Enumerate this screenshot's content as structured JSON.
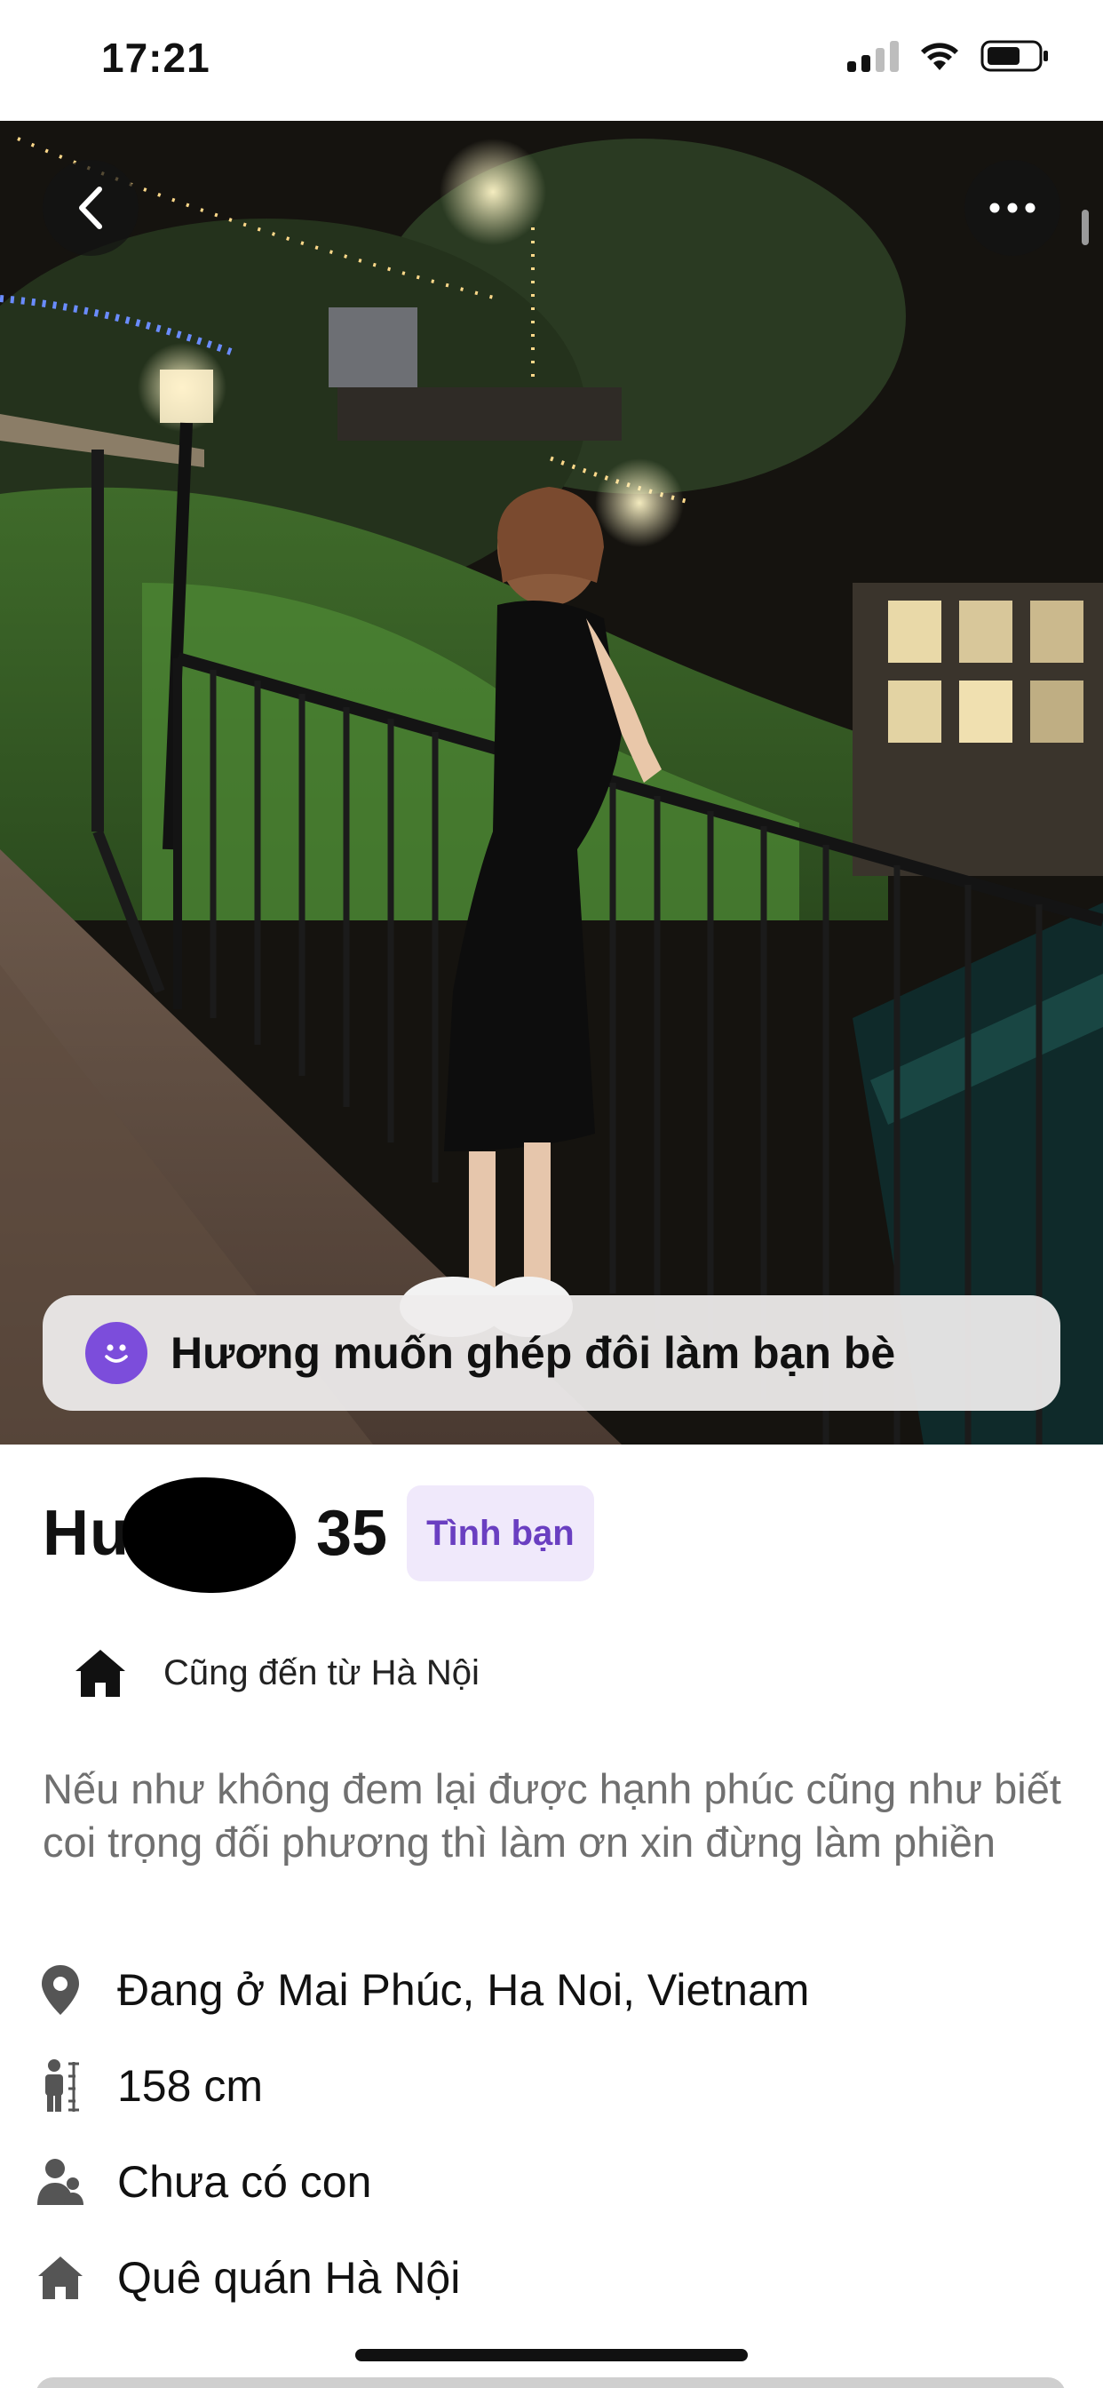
{
  "status_bar": {
    "time": "17:21"
  },
  "hero": {
    "image": "profile-photo-night-balcony",
    "intent_text": "Hương muốn ghép đôi làm bạn bè",
    "intent_emoji_color": "#7c4ddb"
  },
  "profile": {
    "name": "Hu",
    "age": "35",
    "tag": "Tình bạn",
    "hometown_line": "Cũng đến từ Hà Nội",
    "bio": "Nếu như không đem lại được hạnh phúc cũng như biết coi trọng đối phương thì làm ơn xin đừng làm phiền"
  },
  "details": [
    {
      "icon": "location-pin-icon",
      "text": "Đang ở Mai Phúc, Ha Noi, Vietnam"
    },
    {
      "icon": "height-icon",
      "text": "158 cm"
    },
    {
      "icon": "children-icon",
      "text": "Chưa có con"
    },
    {
      "icon": "home-icon",
      "text": "Quê quán Hà Nội"
    }
  ],
  "colors": {
    "accent": "#7c4ddb",
    "badge_bg": "#f0e9fb",
    "badge_text": "#6a3fc1",
    "muted_text": "#707070",
    "icon_gray": "#555555"
  }
}
